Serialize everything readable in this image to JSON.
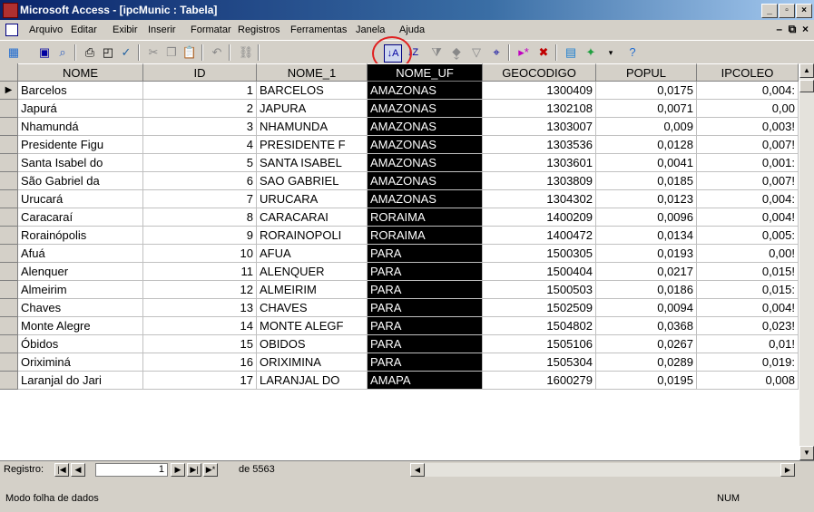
{
  "window": {
    "title": "Microsoft Access - [ipcMunic : Tabela]"
  },
  "menu": [
    "Arquivo",
    "Editar",
    "Exibir",
    "Inserir",
    "Formatar",
    "Registros",
    "Ferramentas",
    "Janela",
    "Ajuda"
  ],
  "table": {
    "columns": [
      "NOME",
      "ID",
      "NOME_1",
      "NOME_UF",
      "GEOCODIGO",
      "POPUL",
      "IPCOLEO"
    ],
    "rows": [
      [
        "Barcelos",
        "1",
        "BARCELOS",
        "AMAZONAS",
        "1300409",
        "0,0175",
        "0,004:"
      ],
      [
        "Japurá",
        "2",
        "JAPURA",
        "AMAZONAS",
        "1302108",
        "0,0071",
        "0,00"
      ],
      [
        "Nhamundá",
        "3",
        "NHAMUNDA",
        "AMAZONAS",
        "1303007",
        "0,009",
        "0,003!"
      ],
      [
        "Presidente Figu",
        "4",
        "PRESIDENTE F",
        "AMAZONAS",
        "1303536",
        "0,0128",
        "0,007!"
      ],
      [
        "Santa Isabel do",
        "5",
        "SANTA ISABEL",
        "AMAZONAS",
        "1303601",
        "0,0041",
        "0,001:"
      ],
      [
        "São Gabriel da",
        "6",
        "SAO GABRIEL",
        "AMAZONAS",
        "1303809",
        "0,0185",
        "0,007!"
      ],
      [
        "Urucará",
        "7",
        "URUCARA",
        "AMAZONAS",
        "1304302",
        "0,0123",
        "0,004:"
      ],
      [
        "Caracaraí",
        "8",
        "CARACARAI",
        "RORAIMA",
        "1400209",
        "0,0096",
        "0,004!"
      ],
      [
        "Rorainópolis",
        "9",
        "RORAINOPOLI",
        "RORAIMA",
        "1400472",
        "0,0134",
        "0,005:"
      ],
      [
        "Afuá",
        "10",
        "AFUA",
        "PARA",
        "1500305",
        "0,0193",
        "0,00!"
      ],
      [
        "Alenquer",
        "11",
        "ALENQUER",
        "PARA",
        "1500404",
        "0,0217",
        "0,015!"
      ],
      [
        "Almeirim",
        "12",
        "ALMEIRIM",
        "PARA",
        "1500503",
        "0,0186",
        "0,015:"
      ],
      [
        "Chaves",
        "13",
        "CHAVES",
        "PARA",
        "1502509",
        "0,0094",
        "0,004!"
      ],
      [
        "Monte Alegre",
        "14",
        "MONTE ALEGF",
        "PARA",
        "1504802",
        "0,0368",
        "0,023!"
      ],
      [
        "Óbidos",
        "15",
        "OBIDOS",
        "PARA",
        "1505106",
        "0,0267",
        "0,01!"
      ],
      [
        "Oriximiná",
        "16",
        "ORIXIMINA",
        "PARA",
        "1505304",
        "0,0289",
        "0,019:"
      ],
      [
        "Laranjal do Jari",
        "17",
        "LARANJAL DO",
        "AMAPA",
        "1600279",
        "0,0195",
        "0,008"
      ]
    ]
  },
  "nav": {
    "label": "Registro:",
    "current": "1",
    "of_text": "de 5563"
  },
  "status": {
    "mode": "Modo folha de dados",
    "num": "NUM"
  }
}
